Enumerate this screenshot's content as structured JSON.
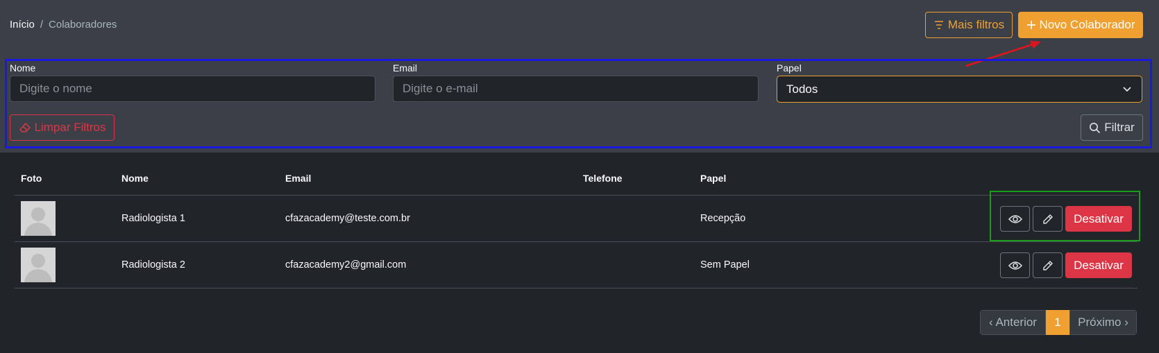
{
  "breadcrumb": {
    "home": "Início",
    "separator": "/",
    "current": "Colaboradores"
  },
  "header": {
    "more_filters_label": "Mais filtros",
    "new_label": "Novo Colaborador"
  },
  "filters": {
    "name_label": "Nome",
    "name_placeholder": "Digite o nome",
    "email_label": "Email",
    "email_placeholder": "Digite o e-mail",
    "role_label": "Papel",
    "role_selected": "Todos",
    "clear_label": "Limpar Filtros",
    "filter_label": "Filtrar"
  },
  "table": {
    "columns": [
      "Foto",
      "Nome",
      "Email",
      "Telefone",
      "Papel"
    ],
    "rows": [
      {
        "name": "Radiologista 1",
        "email": "cfazacademy@teste.com.br",
        "phone": "",
        "role": "Recepção",
        "deactivate": "Desativar"
      },
      {
        "name": "Radiologista 2",
        "email": "cfazacademy2@gmail.com",
        "phone": "",
        "role": "Sem Papel",
        "deactivate": "Desativar"
      }
    ]
  },
  "pagination": {
    "prev": "‹ Anterior",
    "current": "1",
    "next": "Próximo ›"
  },
  "colors": {
    "accent": "#f0a030",
    "danger": "#dc3545",
    "annotation_blue": "#1a1adf",
    "annotation_green": "#1a9e1a",
    "annotation_arrow": "#e0141e"
  },
  "icons": [
    "filter-lines-icon",
    "plus-icon",
    "chevron-down-icon",
    "eraser-icon",
    "search-icon",
    "eye-icon",
    "pencil-icon",
    "user-silhouette-icon"
  ]
}
